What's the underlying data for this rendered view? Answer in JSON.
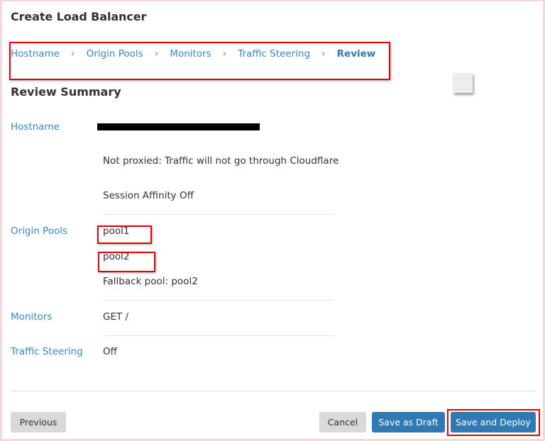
{
  "page": {
    "title": "Create Load Balancer",
    "section_title": "Review Summary"
  },
  "breadcrumb": {
    "items": [
      {
        "label": "Hostname",
        "active": false
      },
      {
        "label": "Origin Pools",
        "active": false
      },
      {
        "label": "Monitors",
        "active": false
      },
      {
        "label": "Traffic Steering",
        "active": false
      },
      {
        "label": "Review",
        "active": true
      }
    ],
    "separator": "›"
  },
  "summary": {
    "hostname": {
      "label": "Hostname",
      "value_redacted": true,
      "proxy_status": "Not proxied: Traffic will not go through Cloudflare",
      "session_affinity": "Session Affinity Off"
    },
    "origin_pools": {
      "label": "Origin Pools",
      "pools": [
        "pool1",
        "pool2"
      ],
      "fallback": "Fallback pool: pool2"
    },
    "monitors": {
      "label": "Monitors",
      "value": "GET /"
    },
    "traffic_steering": {
      "label": "Traffic Steering",
      "value": "Off"
    }
  },
  "footer": {
    "previous_label": "Previous",
    "cancel_label": "Cancel",
    "save_draft_label": "Save as Draft",
    "save_deploy_label": "Save and Deploy"
  },
  "colors": {
    "accent": "#2f7ab2",
    "link": "#3a86be",
    "annotation": "#e00000"
  }
}
